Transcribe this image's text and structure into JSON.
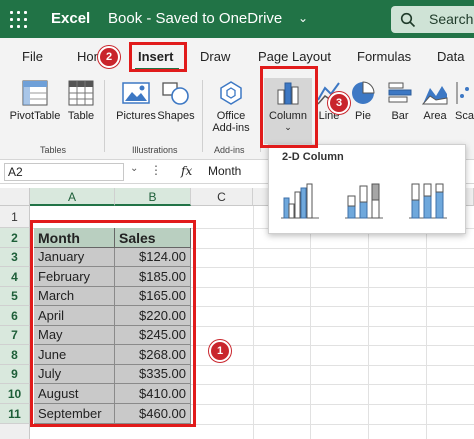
{
  "titlebar": {
    "app_name": "Excel",
    "document_title": "Book - Saved to OneDrive",
    "search_label": "Search"
  },
  "tabs": [
    {
      "label": "File"
    },
    {
      "label": "Home"
    },
    {
      "label": "Insert",
      "active": true
    },
    {
      "label": "Draw"
    },
    {
      "label": "Page Layout"
    },
    {
      "label": "Formulas"
    },
    {
      "label": "Data"
    }
  ],
  "ribbon": {
    "pivottable": "PivotTable",
    "table": "Table",
    "pictures": "Pictures",
    "shapes": "Shapes",
    "office_addins_1": "Office",
    "office_addins_2": "Add-ins",
    "column": "Column",
    "line": "Line",
    "pie": "Pie",
    "bar": "Bar",
    "area": "Area",
    "scatter": "Sca",
    "group_tables": "Tables",
    "group_illustrations": "Illustrations",
    "group_addins": "Add-ins"
  },
  "formula_bar": {
    "name_box": "A2",
    "fx": "fx",
    "value": "Month"
  },
  "grid": {
    "columns": [
      "A",
      "B",
      "C"
    ],
    "rows": [
      "1",
      "2",
      "3",
      "4",
      "5",
      "6",
      "7",
      "8",
      "9",
      "10",
      "11"
    ],
    "header": {
      "month": "Month",
      "sales": "Sales"
    },
    "data": [
      {
        "month": "January",
        "sales": "$124.00"
      },
      {
        "month": "February",
        "sales": "$185.00"
      },
      {
        "month": "March",
        "sales": "$165.00"
      },
      {
        "month": "April",
        "sales": "$220.00"
      },
      {
        "month": "May",
        "sales": "$245.00"
      },
      {
        "month": "June",
        "sales": "$268.00"
      },
      {
        "month": "July",
        "sales": "$335.00"
      },
      {
        "month": "August",
        "sales": "$410.00"
      },
      {
        "month": "September",
        "sales": "$460.00"
      }
    ]
  },
  "chart_dropdown": {
    "title": "2-D Column"
  },
  "callouts": {
    "one": "1",
    "two": "2",
    "three": "3"
  },
  "colors": {
    "excel_green": "#217346",
    "callout_red": "#e11b1b",
    "badge_red": "#c9252c"
  }
}
